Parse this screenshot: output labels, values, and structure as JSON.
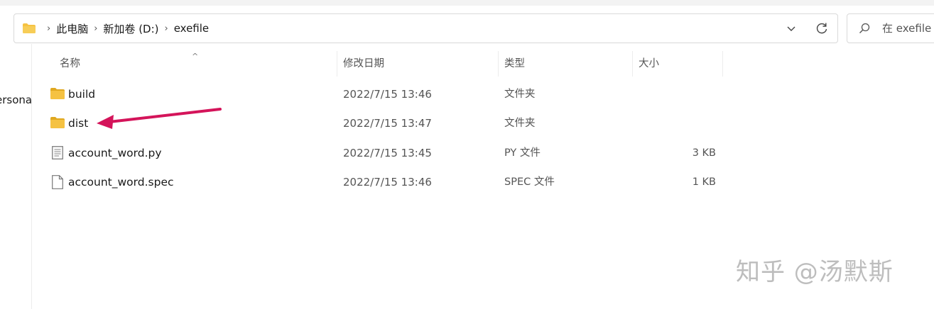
{
  "address": {
    "breadcrumbs": [
      "此电脑",
      "新加卷 (D:)",
      "exefile"
    ]
  },
  "search": {
    "placeholder": "在 exefile 中搜索"
  },
  "nav": {
    "partial_label": "ersona"
  },
  "columns": {
    "name": "名称",
    "date": "修改日期",
    "type": "类型",
    "size": "大小"
  },
  "files": [
    {
      "name": "build",
      "date": "2022/7/15 13:46",
      "type": "文件夹",
      "size": "",
      "icon": "folder-icon"
    },
    {
      "name": "dist",
      "date": "2022/7/15 13:47",
      "type": "文件夹",
      "size": "",
      "icon": "folder-icon"
    },
    {
      "name": "account_word.py",
      "date": "2022/7/15 13:45",
      "type": "PY 文件",
      "size": "3 KB",
      "icon": "text-file-icon"
    },
    {
      "name": "account_word.spec",
      "date": "2022/7/15 13:46",
      "type": "SPEC 文件",
      "size": "1 KB",
      "icon": "file-icon"
    }
  ],
  "annotation": {
    "arrow_color": "#d4145a"
  },
  "watermark": "知乎 @汤默斯",
  "colors": {
    "folder": "#f5c242",
    "folder_dark": "#e0a820",
    "border": "#d9d9d9"
  }
}
